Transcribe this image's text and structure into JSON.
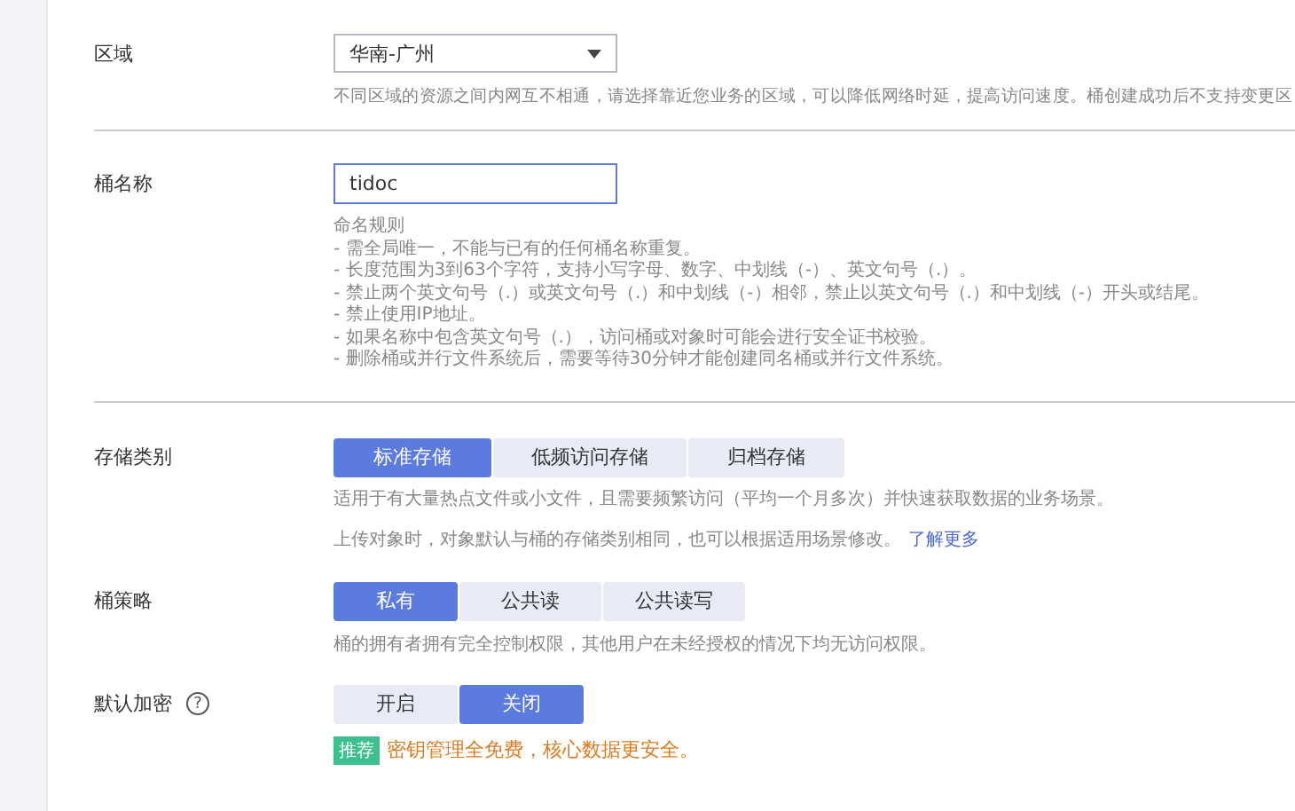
{
  "region": {
    "label": "区域",
    "value": "华南-广州",
    "hint": "不同区域的资源之间内网互不相通，请选择靠近您业务的区域，可以降低网络时延，提高访问速度。桶创建成功后不支持变更区"
  },
  "bucket_name": {
    "label": "桶名称",
    "value": "tidoc",
    "rules_title": "命名规则",
    "rules": [
      "- 需全局唯一，不能与已有的任何桶名称重复。",
      "- 长度范围为3到63个字符，支持小写字母、数字、中划线（-）、英文句号（.）。",
      "- 禁止两个英文句号（.）或英文句号（.）和中划线（-）相邻，禁止以英文句号（.）和中划线（-）开头或结尾。",
      "- 禁止使用IP地址。",
      "- 如果名称中包含英文句号（.），访问桶或对象时可能会进行安全证书校验。",
      "- 删除桶或并行文件系统后，需要等待30分钟才能创建同名桶或并行文件系统。"
    ]
  },
  "storage_class": {
    "label": "存储类别",
    "options": [
      {
        "label": "标准存储",
        "selected": true
      },
      {
        "label": "低频访问存储",
        "selected": false
      },
      {
        "label": "归档存储",
        "selected": false
      }
    ],
    "hint": "适用于有大量热点文件或小文件，且需要频繁访问（平均一个月多次）并快速获取数据的业务场景。",
    "note": "上传对象时，对象默认与桶的存储类别相同，也可以根据适用场景修改。",
    "link": "了解更多"
  },
  "bucket_policy": {
    "label": "桶策略",
    "options": [
      {
        "label": "私有",
        "selected": true
      },
      {
        "label": "公共读",
        "selected": false
      },
      {
        "label": "公共读写",
        "selected": false
      }
    ],
    "hint": "桶的拥有者拥有完全控制权限，其他用户在未经授权的情况下均无访问权限。"
  },
  "default_encryption": {
    "label": "默认加密",
    "help": "?",
    "options": [
      {
        "label": "开启",
        "selected": false
      },
      {
        "label": "关闭",
        "selected": true
      }
    ],
    "badge": "推荐",
    "promo": "密钥管理全免费，核心数据更安全。"
  }
}
